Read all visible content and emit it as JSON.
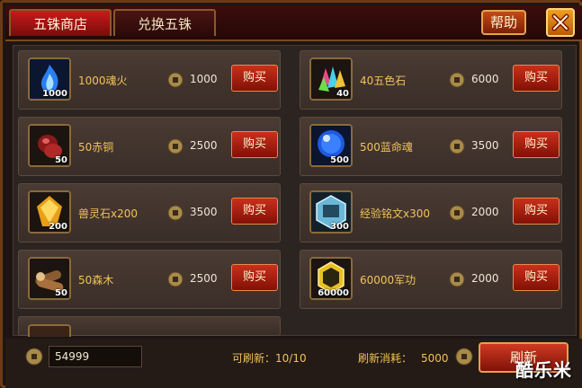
{
  "tabs": [
    "五铢商店",
    "兑换五铢"
  ],
  "help_label": "帮助",
  "items": [
    {
      "name": "1000魂火",
      "qty": "1000",
      "price": "1000",
      "icon": "blue-flame-icon"
    },
    {
      "name": "40五色石",
      "qty": "40",
      "price": "6000",
      "icon": "five-color-stone-icon"
    },
    {
      "name": "50赤铜",
      "qty": "50",
      "price": "2500",
      "icon": "red-copper-icon"
    },
    {
      "name": "500蓝命魂",
      "qty": "500",
      "price": "3500",
      "icon": "blue-orb-icon"
    },
    {
      "name": "兽灵石x200",
      "qty": "200",
      "price": "3500",
      "icon": "beast-spirit-stone-icon"
    },
    {
      "name": "经验铭文x300",
      "qty": "300",
      "price": "2000",
      "icon": "exp-inscription-icon"
    },
    {
      "name": "50森木",
      "qty": "50",
      "price": "2500",
      "icon": "wood-logs-icon"
    },
    {
      "name": "60000军功",
      "qty": "60000",
      "price": "2000",
      "icon": "military-merit-icon"
    }
  ],
  "buy_label": "购买",
  "currency_amount": "54999",
  "refresh_count": "可刷新：10/10",
  "refresh_cost_label": "刷新消耗：",
  "refresh_cost": "5000",
  "refresh_label": "刷新",
  "watermark": "酷乐米",
  "colors": {
    "accent": "#c81b1b",
    "gold_text": "#f0c25a",
    "frame": "#6e3a14"
  }
}
